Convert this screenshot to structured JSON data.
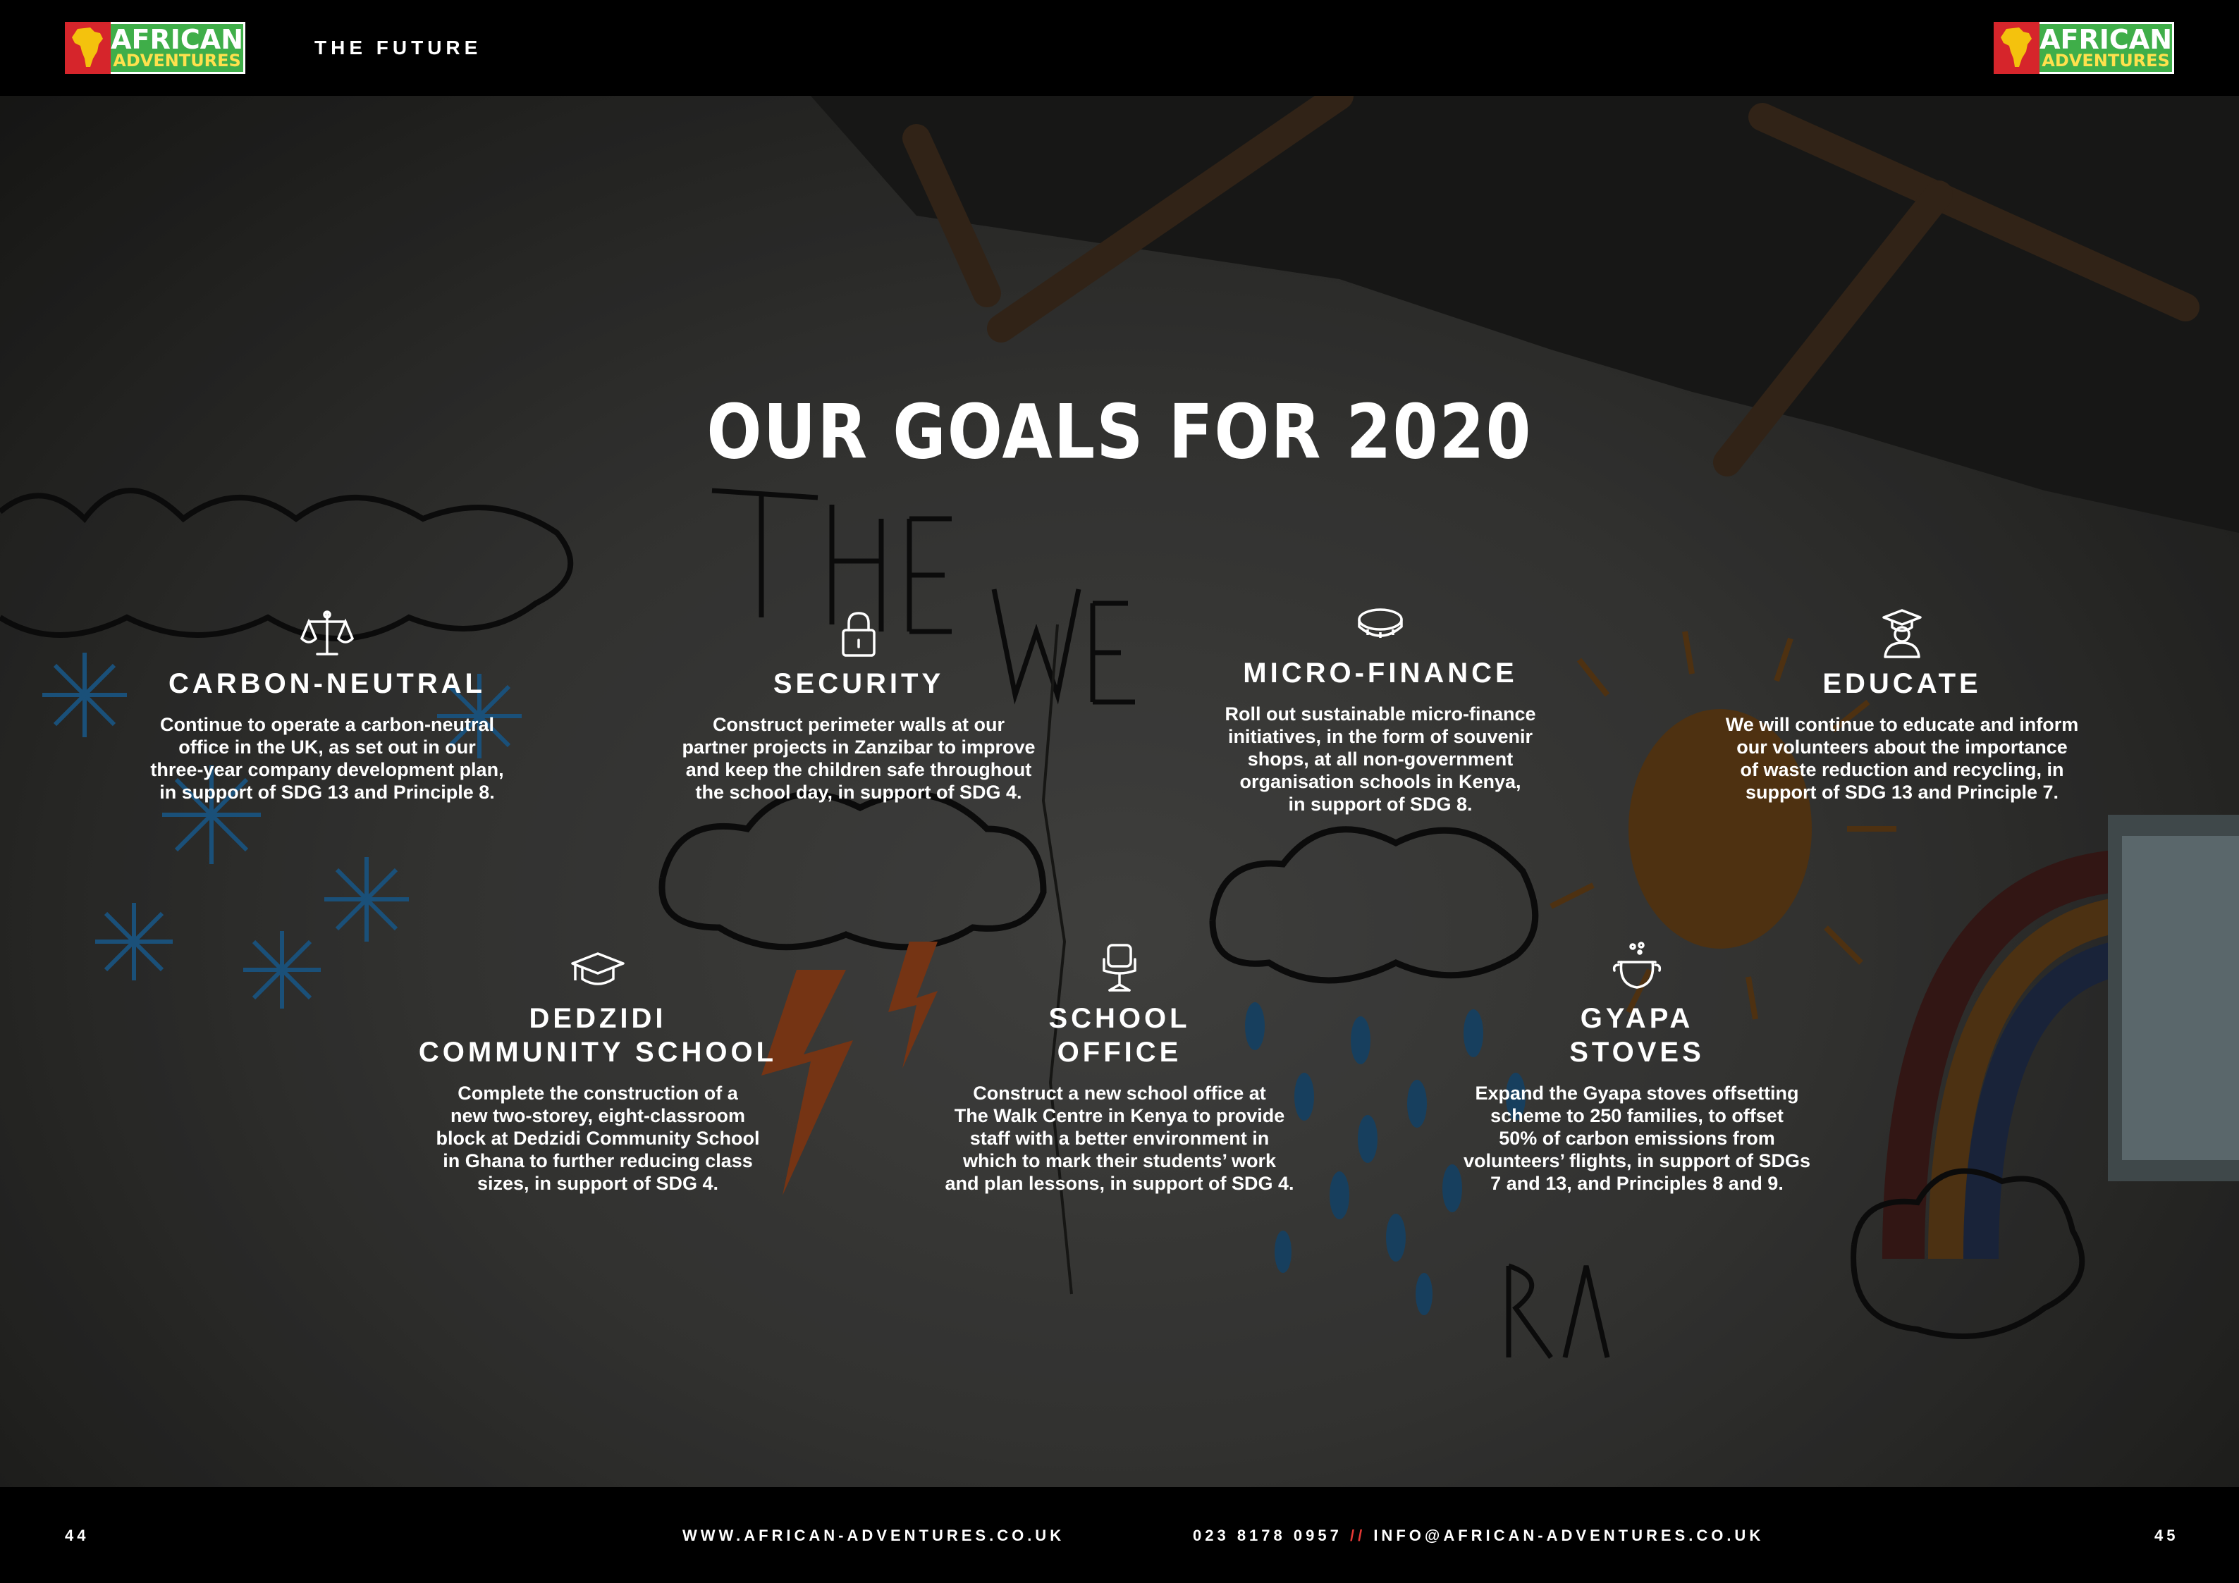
{
  "header": {
    "logo": {
      "line1": "AFRICAN",
      "line2": "ADVENTURES"
    },
    "section_title": "THE FUTURE"
  },
  "title": "OUR GOALS FOR 2020",
  "goals": [
    {
      "icon": "scales-icon",
      "title": "CARBON-NEUTRAL",
      "text": "Continue to operate a carbon-neutral\noffice in the UK, as set out in our\nthree-year company development plan,\nin support of SDG 13 and Principle 8."
    },
    {
      "icon": "padlock-icon",
      "title": "SECURITY",
      "text": "Construct perimeter walls at our\npartner projects in Zanzibar to improve\nand keep the children safe throughout\nthe school day, in support of SDG 4."
    },
    {
      "icon": "coin-icon",
      "title": "MICRO-FINANCE",
      "text": "Roll out sustainable micro-finance\ninitiatives, in the form of souvenir\nshops, at all non-government\norganisation schools in Kenya,\nin support of SDG 8."
    },
    {
      "icon": "graduate-icon",
      "title": "EDUCATE",
      "text": "We will continue to educate and inform\nour volunteers about the importance\nof waste reduction and recycling, in\nsupport of SDG 13 and Principle 7."
    },
    {
      "icon": "mortarboard-icon",
      "title": "DEDZIDI\nCOMMUNITY SCHOOL",
      "text": "Complete the construction of a\nnew two-storey, eight-classroom\nblock at Dedzidi Community School\nin Ghana to further reducing class\nsizes, in support of SDG 4."
    },
    {
      "icon": "office-chair-icon",
      "title": "SCHOOL\nOFFICE",
      "text": "Construct a new school office at\nThe Walk Centre in Kenya to provide\nstaff with a better environment in\nwhich to mark their students’ work\nand plan lessons, in support of SDG 4."
    },
    {
      "icon": "cooking-pot-icon",
      "title": "GYAPA\nSTOVES",
      "text": "Expand the Gyapa stoves offsetting\nscheme to 250 families, to offset\n50% of carbon emissions from\nvolunteers’ flights, in support of SDGs\n7 and 13, and Principles 8 and 9."
    }
  ],
  "footer": {
    "page_left": "44",
    "website": "WWW.AFRICAN-ADVENTURES.CO.UK",
    "phone": "023 8178 0957",
    "separator": "//",
    "email": "INFO@AFRICAN-ADVENTURES.CO.UK",
    "page_right": "45"
  },
  "colors": {
    "logo_red": "#d6252b",
    "logo_green": "#3fae49",
    "logo_yellow": "#ffe14d",
    "separator": "#e53935"
  }
}
